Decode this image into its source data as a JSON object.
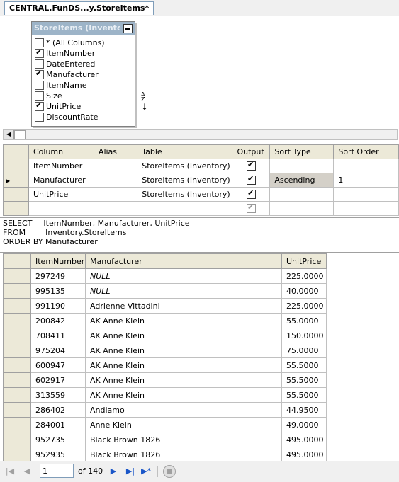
{
  "tab": {
    "title": "CENTRAL.FunDS...y.StoreItems*"
  },
  "diagram": {
    "table_title": "StoreItems (Inventory)",
    "columns": [
      {
        "label": "* (All Columns)",
        "checked": false
      },
      {
        "label": "ItemNumber",
        "checked": true
      },
      {
        "label": "DateEntered",
        "checked": false
      },
      {
        "label": "Manufacturer",
        "checked": true
      },
      {
        "label": "ItemName",
        "checked": false
      },
      {
        "label": "Size",
        "checked": false
      },
      {
        "label": "UnitPrice",
        "checked": true
      },
      {
        "label": "DiscountRate",
        "checked": false
      }
    ],
    "sort_icon": "sort-ascending-icon"
  },
  "criteria": {
    "headers": [
      "Column",
      "Alias",
      "Table",
      "Output",
      "Sort Type",
      "Sort Order"
    ],
    "rows": [
      {
        "column": "ItemNumber",
        "alias": "",
        "table": "StoreItems (Inventory)",
        "output": true,
        "sort_type": "",
        "sort_order": ""
      },
      {
        "column": "Manufacturer",
        "alias": "",
        "table": "StoreItems (Inventory)",
        "output": true,
        "sort_type": "Ascending",
        "sort_order": "1"
      },
      {
        "column": "UnitPrice",
        "alias": "",
        "table": "StoreItems (Inventory)",
        "output": true,
        "sort_type": "",
        "sort_order": ""
      },
      {
        "column": "",
        "alias": "",
        "table": "",
        "output": true,
        "sort_type": "",
        "sort_order": ""
      }
    ]
  },
  "sql": {
    "line1_kw": "SELECT",
    "line1_rest": "ItemNumber, Manufacturer, UnitPrice",
    "line2_kw": "FROM",
    "line2_rest": "Inventory.StoreItems",
    "line3": "ORDER BY Manufacturer"
  },
  "results": {
    "headers": [
      "ItemNumber",
      "Manufacturer",
      "UnitPrice"
    ],
    "rows": [
      [
        "297249",
        "NULL",
        "225.0000"
      ],
      [
        "995135",
        "NULL",
        "40.0000"
      ],
      [
        "991190",
        "Adrienne Vittadini",
        "225.0000"
      ],
      [
        "200842",
        "AK Anne Klein",
        "55.0000"
      ],
      [
        "708411",
        "AK Anne Klein",
        "150.0000"
      ],
      [
        "975204",
        "AK Anne Klein",
        "75.0000"
      ],
      [
        "600947",
        "AK Anne Klein",
        "55.5000"
      ],
      [
        "602917",
        "AK Anne Klein",
        "55.5000"
      ],
      [
        "313559",
        "AK Anne Klein",
        "55.5000"
      ],
      [
        "286402",
        "Andiamo",
        "44.9500"
      ],
      [
        "284001",
        "Anne Klein",
        "49.0000"
      ],
      [
        "952735",
        "Black Brown 1826",
        "495.0000"
      ],
      [
        "952935",
        "Black Brown 1826",
        "495.0000"
      ]
    ]
  },
  "navbar": {
    "page_value": "1",
    "page_count": "of 140"
  }
}
